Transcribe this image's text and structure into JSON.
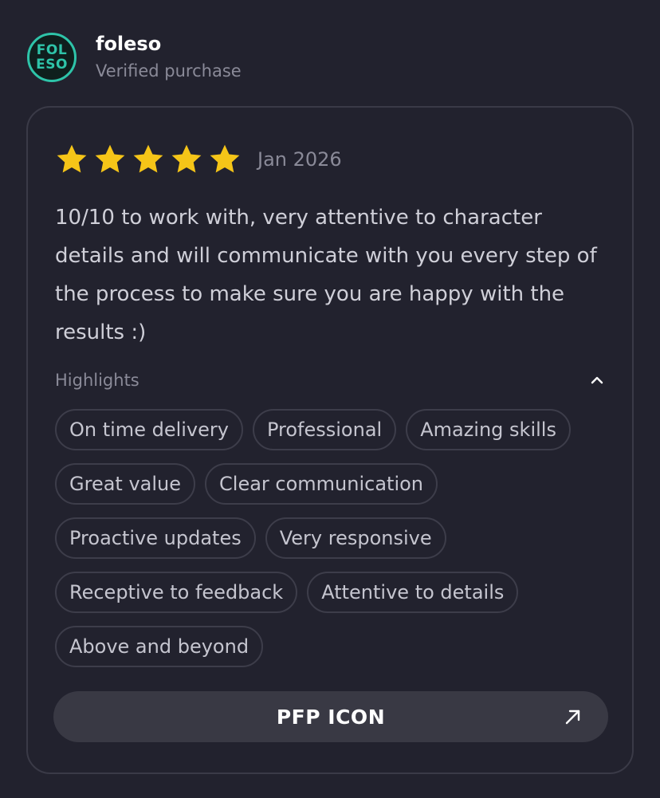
{
  "reviewer": {
    "avatar_line1": "FOL",
    "avatar_line2": "ESO",
    "name": "foleso",
    "status": "Verified purchase"
  },
  "review": {
    "rating": 5,
    "rating_max": 5,
    "star_color": "#f5c518",
    "date": "Jan 2026",
    "text": "10/10 to work with, very attentive to character details and will communicate with you every step of the process to make sure you are happy with the results :)"
  },
  "highlights": {
    "label": "Highlights",
    "expanded": true,
    "items": [
      "On time delivery",
      "Professional",
      "Amazing skills",
      "Great value",
      "Clear communication",
      "Proactive updates",
      "Very responsive",
      "Receptive to feedback",
      "Attentive to details",
      "Above and beyond"
    ]
  },
  "action": {
    "label": "PFP ICON",
    "icon": "arrow-up-right-icon"
  },
  "colors": {
    "background": "#22222e",
    "accent": "#2ec4a9",
    "button": "#393944"
  }
}
